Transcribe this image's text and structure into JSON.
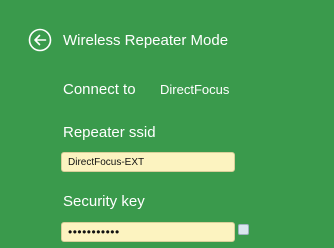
{
  "header": {
    "title": "Wireless Repeater Mode",
    "back_icon": "circle-arrow-left-icon"
  },
  "connection": {
    "label": "Connect to",
    "value": "DirectFocus"
  },
  "repeater_ssid": {
    "label": "Repeater ssid",
    "value": "DirectFocus-EXT"
  },
  "security_key": {
    "label": "Security key",
    "masked_value": "•••••••••••"
  },
  "colors": {
    "background": "#3a9a4c",
    "text": "#ffffff",
    "field_background": "#fcf3c0"
  }
}
